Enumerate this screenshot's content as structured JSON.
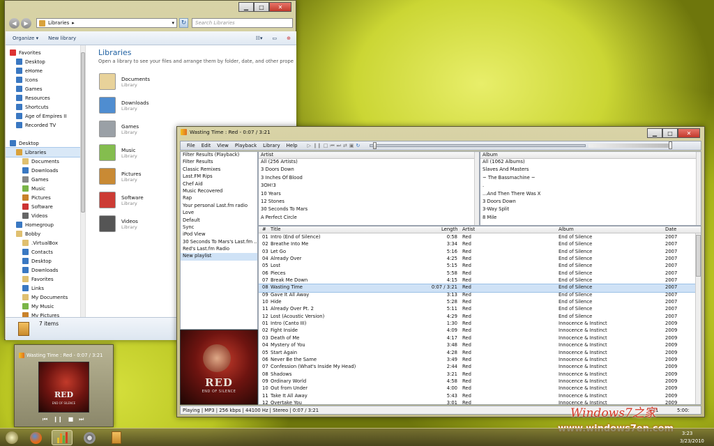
{
  "explorer": {
    "address": "Libraries",
    "search_placeholder": "Search Libraries",
    "toolbar": {
      "organize": "Organize ▾",
      "new_library": "New library"
    },
    "nav": [
      {
        "label": "Favorites",
        "indent": 0,
        "color": "#d33"
      },
      {
        "label": "Desktop",
        "indent": 1,
        "color": "#3a78c2"
      },
      {
        "label": "eHome",
        "indent": 1,
        "color": "#3a78c2"
      },
      {
        "label": "Icons",
        "indent": 1,
        "color": "#3a78c2"
      },
      {
        "label": "Games",
        "indent": 1,
        "color": "#3a78c2"
      },
      {
        "label": "Resources",
        "indent": 1,
        "color": "#3a78c2"
      },
      {
        "label": "Shortcuts",
        "indent": 1,
        "color": "#3a78c2"
      },
      {
        "label": "Age of Empires II",
        "indent": 1,
        "color": "#3a78c2"
      },
      {
        "label": "Recorded TV",
        "indent": 1,
        "color": "#3a78c2"
      },
      {
        "label": "",
        "indent": 0,
        "color": ""
      },
      {
        "label": "Desktop",
        "indent": 0,
        "color": "#3a78c2"
      },
      {
        "label": "Libraries",
        "indent": 1,
        "color": "#d9a23c",
        "selected": true
      },
      {
        "label": "Documents",
        "indent": 2,
        "color": "#e0c070"
      },
      {
        "label": "Downloads",
        "indent": 2,
        "color": "#3a78c2"
      },
      {
        "label": "Games",
        "indent": 2,
        "color": "#888"
      },
      {
        "label": "Music",
        "indent": 2,
        "color": "#7ab548"
      },
      {
        "label": "Pictures",
        "indent": 2,
        "color": "#c9822a"
      },
      {
        "label": "Software",
        "indent": 2,
        "color": "#c33"
      },
      {
        "label": "Videos",
        "indent": 2,
        "color": "#666"
      },
      {
        "label": "Homegroup",
        "indent": 1,
        "color": "#3a78c2"
      },
      {
        "label": "Bobby",
        "indent": 1,
        "color": "#e0c070"
      },
      {
        "label": ".VirtualBox",
        "indent": 2,
        "color": "#e0c070"
      },
      {
        "label": "Contacts",
        "indent": 2,
        "color": "#3a78c2"
      },
      {
        "label": "Desktop",
        "indent": 2,
        "color": "#3a78c2"
      },
      {
        "label": "Downloads",
        "indent": 2,
        "color": "#3a78c2"
      },
      {
        "label": "Favorites",
        "indent": 2,
        "color": "#e0c070"
      },
      {
        "label": "Links",
        "indent": 2,
        "color": "#3a78c2"
      },
      {
        "label": "My Documents",
        "indent": 2,
        "color": "#e0c070"
      },
      {
        "label": "My Music",
        "indent": 2,
        "color": "#7ab548"
      },
      {
        "label": "My Pictures",
        "indent": 2,
        "color": "#c9822a"
      }
    ],
    "heading": "Libraries",
    "description": "Open a library to see your files and arrange them by folder, date, and other proper...",
    "libraries": [
      {
        "name": "Documents",
        "type": "Library",
        "color": "#e8d29a"
      },
      {
        "name": "Downloads",
        "type": "Library",
        "color": "#4f8dd0"
      },
      {
        "name": "Games",
        "type": "Library",
        "color": "#9aa0a6"
      },
      {
        "name": "Music",
        "type": "Library",
        "color": "#84bd4e"
      },
      {
        "name": "Pictures",
        "type": "Library",
        "color": "#c98a34"
      },
      {
        "name": "Software",
        "type": "Library",
        "color": "#cc3b34"
      },
      {
        "name": "Videos",
        "type": "Library",
        "color": "#555"
      }
    ],
    "status": "7 items"
  },
  "player": {
    "title": "Wasting Time : Red - 0:07 / 3:21",
    "menu": [
      "File",
      "Edit",
      "View",
      "Playback",
      "Library",
      "Help"
    ],
    "playlists": [
      "Filter Results (Playback)",
      "Filter Results",
      "Classic Remixes",
      "Last.FM Rips",
      "Chef Aid",
      "Music Recovered",
      "Rap",
      "Your personal Last.fm radio",
      "Love",
      "Default",
      "Sync",
      "iPod View",
      "30 Seconds To Mars's Last.fm ...",
      "Red's Last.fm Radio",
      "New playlist"
    ],
    "artist_header": "Artist",
    "artists": [
      "All (256 Artists)",
      "3 Doors Down",
      "3 Inches Of Blood",
      "3OH!3",
      "10 Years",
      "12 Stones",
      "30 Seconds To Mars",
      "A Perfect Circle"
    ],
    "album_header": "Album",
    "albums": [
      "All (1062 Albums)",
      "Slaves And Masters",
      "~ The Bassmachine ~",
      ".",
      "...And Then There Was X",
      "3 Doors Down",
      "3-Way Split",
      "8 Mile"
    ],
    "columns": {
      "num": "#",
      "title": "Title",
      "length": "Length",
      "artist": "Artist",
      "album": "Album",
      "date": "Date"
    },
    "tracks": [
      [
        "01",
        "Intro (End of Silence)",
        "0:58",
        "Red",
        "End of Silence",
        "2007"
      ],
      [
        "02",
        "Breathe Into Me",
        "3:34",
        "Red",
        "End of Silence",
        "2007"
      ],
      [
        "03",
        "Let Go",
        "5:16",
        "Red",
        "End of Silence",
        "2007"
      ],
      [
        "04",
        "Already Over",
        "4:25",
        "Red",
        "End of Silence",
        "2007"
      ],
      [
        "05",
        "Lost",
        "5:15",
        "Red",
        "End of Silence",
        "2007"
      ],
      [
        "06",
        "Pieces",
        "5:58",
        "Red",
        "End of Silence",
        "2007"
      ],
      [
        "07",
        "Break Me Down",
        "4:15",
        "Red",
        "End of Silence",
        "2007"
      ],
      [
        "08",
        "Wasting Time",
        "0:07 / 3:21",
        "Red",
        "End of Silence",
        "2007"
      ],
      [
        "09",
        "Gave It All Away",
        "3:13",
        "Red",
        "End of Silence",
        "2007"
      ],
      [
        "10",
        "Hide",
        "5:28",
        "Red",
        "End of Silence",
        "2007"
      ],
      [
        "11",
        "Already Over Pt. 2",
        "5:11",
        "Red",
        "End of Silence",
        "2007"
      ],
      [
        "12",
        "Lost (Acoustic Version)",
        "4:29",
        "Red",
        "End of Silence",
        "2007"
      ],
      [
        "01",
        "Intro (Canto III)",
        "1:30",
        "Red",
        "Innocence & Instinct",
        "2009"
      ],
      [
        "02",
        "Fight Inside",
        "4:09",
        "Red",
        "Innocence & Instinct",
        "2009"
      ],
      [
        "03",
        "Death of Me",
        "4:17",
        "Red",
        "Innocence & Instinct",
        "2009"
      ],
      [
        "04",
        "Mystery of You",
        "3:48",
        "Red",
        "Innocence & Instinct",
        "2009"
      ],
      [
        "05",
        "Start Again",
        "4:28",
        "Red",
        "Innocence & Instinct",
        "2009"
      ],
      [
        "06",
        "Never Be the Same",
        "3:49",
        "Red",
        "Innocence & Instinct",
        "2009"
      ],
      [
        "07",
        "Confession (What's Inside My Head)",
        "2:44",
        "Red",
        "Innocence & Instinct",
        "2009"
      ],
      [
        "08",
        "Shadows",
        "3:21",
        "Red",
        "Innocence & Instinct",
        "2009"
      ],
      [
        "09",
        "Ordinary World",
        "4:58",
        "Red",
        "Innocence & Instinct",
        "2009"
      ],
      [
        "10",
        "Out from Under",
        "4:00",
        "Red",
        "Innocence & Instinct",
        "2009"
      ],
      [
        "11",
        "Take It All Away",
        "5:43",
        "Red",
        "Innocence & Instinct",
        "2009"
      ],
      [
        "12",
        "Overtake You",
        "3:01",
        "Red",
        "Innocence & Instinct",
        "2009"
      ]
    ],
    "selected_index": 7,
    "album_art_text": "END OF SILENCE",
    "status_left": "Playing | MP3 | 256 kbps | 44100 Hz | Stereo | 0:07 / 3:21",
    "status_time": "3:21",
    "status_total": "5:00:"
  },
  "mini": {
    "title": "Wasting Time : Red - 0:07 / 3:21",
    "art_text": "END OF SILENCE"
  },
  "taskbar": {
    "clock_time": "3:23",
    "clock_date": "3/23/2010"
  },
  "watermark": {
    "line1": "Windows7之家",
    "line2": "www.windows7en.com"
  }
}
